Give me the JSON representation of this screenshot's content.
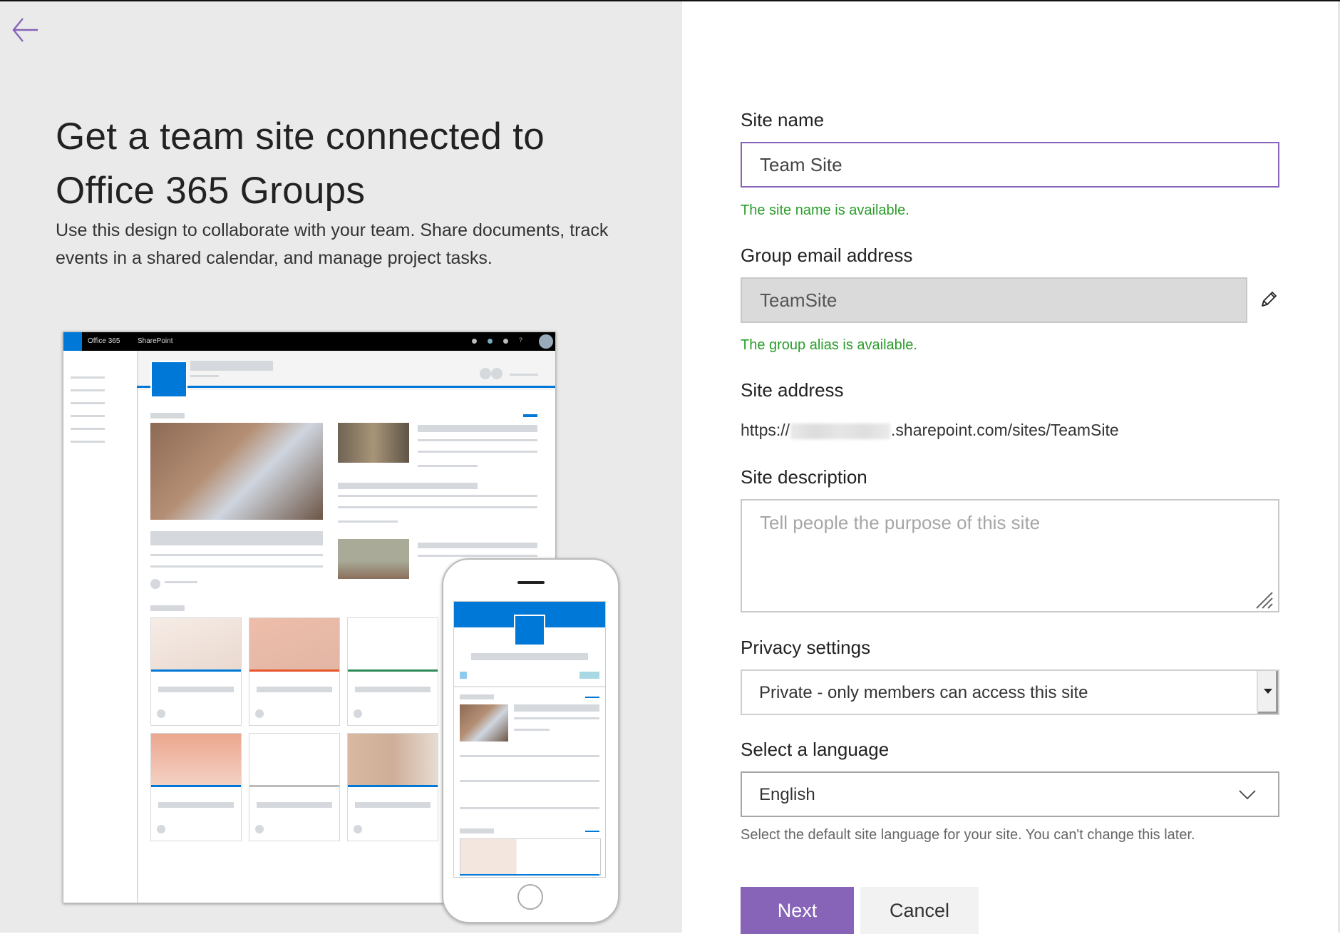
{
  "left_panel": {
    "back_icon": "arrow-left-icon",
    "title": "Get a team site connected to Office 365 Groups",
    "description": "Use this design to collaborate with your team. Share documents, track events in a shared calendar, and manage project tasks.",
    "illustration": {
      "suite_bar_app": "Office 365",
      "suite_bar_product": "SharePoint"
    }
  },
  "form": {
    "site_name": {
      "label": "Site name",
      "value": "Team Site",
      "status": "The site name is available."
    },
    "group_email": {
      "label": "Group email address",
      "value": "TeamSite",
      "status": "The group alias is available.",
      "edit_icon": "pencil-icon"
    },
    "site_address": {
      "label": "Site address",
      "prefix": "https://",
      "suffix": ".sharepoint.com/sites/TeamSite"
    },
    "site_description": {
      "label": "Site description",
      "placeholder": "Tell people the purpose of this site",
      "value": ""
    },
    "privacy": {
      "label": "Privacy settings",
      "selected": "Private - only members can access this site"
    },
    "language": {
      "label": "Select a language",
      "selected": "English",
      "hint": "Select the default site language for your site. You can't change this later."
    },
    "buttons": {
      "next": "Next",
      "cancel": "Cancel"
    }
  },
  "colors": {
    "accent": "#8764b8",
    "success": "#2a9d2a",
    "left_panel_bg": "#eaeaea",
    "illustration_blue": "#0078d7"
  }
}
